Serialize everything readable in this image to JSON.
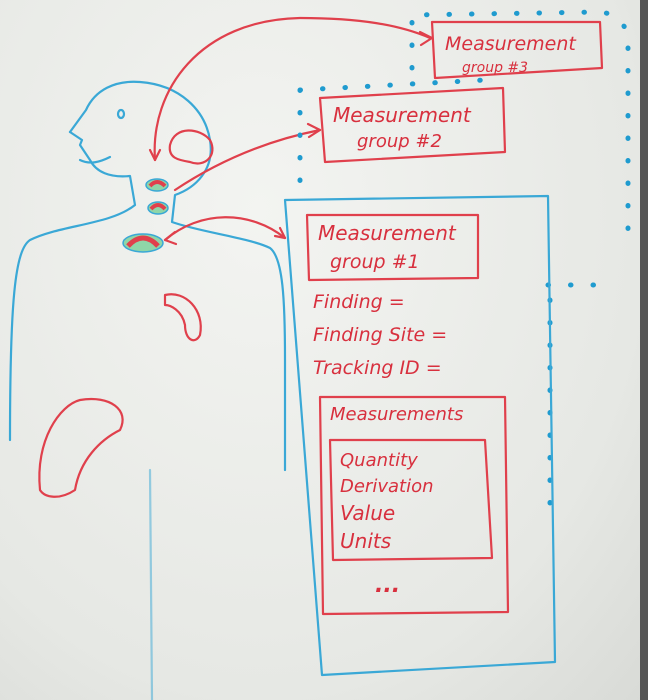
{
  "group3": {
    "title": "Measurement",
    "subtitle": "group #3"
  },
  "group2": {
    "title": "Measurement",
    "subtitle": "group #2"
  },
  "group1": {
    "title": "Measurement",
    "subtitle": "group #1",
    "fields": [
      "Finding =",
      "Finding Site =",
      "Tracking ID ="
    ],
    "measurements": {
      "title": "Measurements",
      "items": [
        "Quantity",
        "Derivation",
        "Value",
        "Units"
      ],
      "more": "..."
    }
  },
  "colors": {
    "red": "#e0404c",
    "blue": "#3aa8d6"
  }
}
